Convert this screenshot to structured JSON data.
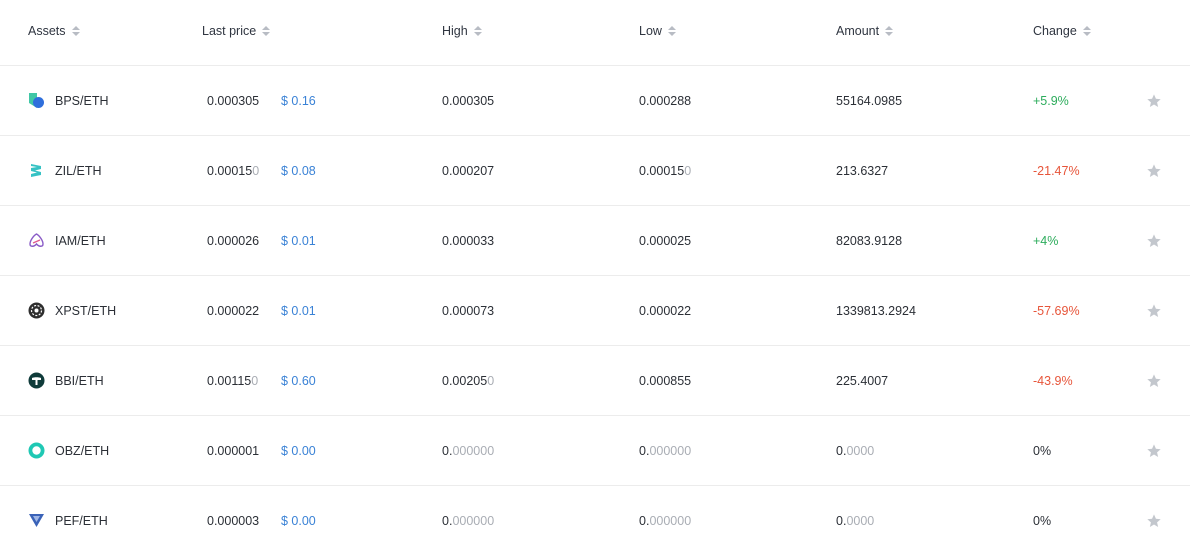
{
  "header": {
    "assets": "Assets",
    "last_price": "Last price",
    "high": "High",
    "low": "Low",
    "amount": "Amount",
    "change": "Change"
  },
  "rows": [
    {
      "pair": "BPS/ETH",
      "icon": "bps-coin-icon",
      "last_main": "0.000305",
      "last_dim": "",
      "usd": "$ 0.16",
      "high_main": "0.000305",
      "high_dim": "",
      "low_main": "0.000288",
      "low_dim": "",
      "amount_main": "55164.0985",
      "amount_dim": "",
      "change": "+5.9%",
      "change_dir": "pos"
    },
    {
      "pair": "ZIL/ETH",
      "icon": "zil-coin-icon",
      "last_main": "0.00015",
      "last_dim": "0",
      "usd": "$ 0.08",
      "high_main": "0.000207",
      "high_dim": "",
      "low_main": "0.00015",
      "low_dim": "0",
      "amount_main": "213.6327",
      "amount_dim": "",
      "change": "-21.47%",
      "change_dir": "neg"
    },
    {
      "pair": "IAM/ETH",
      "icon": "iam-coin-icon",
      "last_main": "0.000026",
      "last_dim": "",
      "usd": "$ 0.01",
      "high_main": "0.000033",
      "high_dim": "",
      "low_main": "0.000025",
      "low_dim": "",
      "amount_main": "82083.9128",
      "amount_dim": "",
      "change": "+4%",
      "change_dir": "pos"
    },
    {
      "pair": "XPST/ETH",
      "icon": "xpst-coin-icon",
      "last_main": "0.000022",
      "last_dim": "",
      "usd": "$ 0.01",
      "high_main": "0.000073",
      "high_dim": "",
      "low_main": "0.000022",
      "low_dim": "",
      "amount_main": "1339813.2924",
      "amount_dim": "",
      "change": "-57.69%",
      "change_dir": "neg"
    },
    {
      "pair": "BBI/ETH",
      "icon": "bbi-coin-icon",
      "last_main": "0.00115",
      "last_dim": "0",
      "usd": "$ 0.60",
      "high_main": "0.00205",
      "high_dim": "0",
      "low_main": "0.000855",
      "low_dim": "",
      "amount_main": "225.4007",
      "amount_dim": "",
      "change": "-43.9%",
      "change_dir": "neg"
    },
    {
      "pair": "OBZ/ETH",
      "icon": "obz-coin-icon",
      "last_main": "0.000001",
      "last_dim": "",
      "usd": "$ 0.00",
      "high_main": "0.",
      "high_dim": "000000",
      "low_main": "0.",
      "low_dim": "000000",
      "amount_main": "0.",
      "amount_dim": "0000",
      "change": "0%",
      "change_dir": "neu"
    },
    {
      "pair": "PEF/ETH",
      "icon": "pef-coin-icon",
      "last_main": "0.000003",
      "last_dim": "",
      "usd": "$ 0.00",
      "high_main": "0.",
      "high_dim": "000000",
      "low_main": "0.",
      "low_dim": "000000",
      "amount_main": "0.",
      "amount_dim": "0000",
      "change": "0%",
      "change_dir": "neu"
    }
  ],
  "colors": {
    "positive": "#2dac5c",
    "negative": "#e7553a",
    "usd": "#3a82d6",
    "star": "#c3c7cd"
  }
}
